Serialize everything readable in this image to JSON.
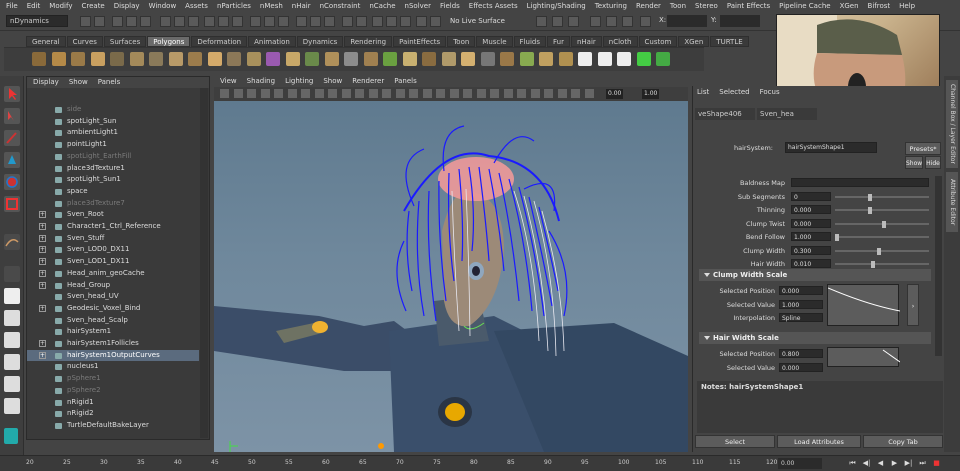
{
  "menubar": [
    "File",
    "Edit",
    "Modify",
    "Create",
    "Display",
    "Window",
    "Assets",
    "nParticles",
    "nMesh",
    "nHair",
    "nConstraint",
    "nCache",
    "nSolver",
    "Fields",
    "Effects Assets",
    "Lighting/Shading",
    "Texturing",
    "Render",
    "Toon",
    "Stereo",
    "Paint Effects",
    "Pipeline Cache",
    "XGen",
    "Bifrost",
    "Help"
  ],
  "status": {
    "mode": "nDynamics",
    "live_surface": "No Live Surface",
    "x_label": "X:",
    "y_label": "Y:"
  },
  "shelf_tabs": [
    "General",
    "Curves",
    "Surfaces",
    "Polygons",
    "Deformation",
    "Animation",
    "Dynamics",
    "Rendering",
    "PaintEffects",
    "Toon",
    "Muscle",
    "Fluids",
    "Fur",
    "nHair",
    "nCloth",
    "Custom",
    "XGen",
    "TURTLE"
  ],
  "shelf_active": "Polygons",
  "outliner": {
    "menu": [
      "Display",
      "Show",
      "Panels"
    ],
    "rows": [
      {
        "label": "side",
        "state": "grey",
        "plus": false
      },
      {
        "label": "spotLight_Sun",
        "state": "",
        "plus": false
      },
      {
        "label": "ambientLight1",
        "state": "",
        "plus": false
      },
      {
        "label": "pointLight1",
        "state": "",
        "plus": false
      },
      {
        "label": "spotLight_EarthFill",
        "state": "grey",
        "plus": false
      },
      {
        "label": "place3dTexture1",
        "state": "",
        "plus": false
      },
      {
        "label": "spotLight_Sun1",
        "state": "",
        "plus": false
      },
      {
        "label": "space",
        "state": "",
        "plus": false
      },
      {
        "label": "place3dTexture7",
        "state": "grey",
        "plus": false
      },
      {
        "label": "Sven_Root",
        "state": "",
        "plus": true
      },
      {
        "label": "Character1_Ctrl_Reference",
        "state": "",
        "plus": true
      },
      {
        "label": "Sven_Stuff",
        "state": "",
        "plus": true
      },
      {
        "label": "Sven_LOD0_DX11",
        "state": "",
        "plus": true
      },
      {
        "label": "Sven_LOD1_DX11",
        "state": "",
        "plus": true
      },
      {
        "label": "Head_anim_geoCache",
        "state": "",
        "plus": true
      },
      {
        "label": "Head_Group",
        "state": "",
        "plus": true
      },
      {
        "label": "Sven_head_UV",
        "state": "",
        "plus": false
      },
      {
        "label": "Geodesic_Voxel_Bind",
        "state": "",
        "plus": true
      },
      {
        "label": "Sven_head_Scalp",
        "state": "",
        "plus": false
      },
      {
        "label": "hairSystem1",
        "state": "",
        "plus": false
      },
      {
        "label": "hairSystem1Follicles",
        "state": "",
        "plus": true
      },
      {
        "label": "hairSystem1OutputCurves",
        "state": "sel",
        "plus": true
      },
      {
        "label": "nucleus1",
        "state": "",
        "plus": false
      },
      {
        "label": "pSphere1",
        "state": "grey",
        "plus": false
      },
      {
        "label": "pSphere2",
        "state": "grey",
        "plus": false
      },
      {
        "label": "nRigid1",
        "state": "",
        "plus": false
      },
      {
        "label": "nRigid2",
        "state": "",
        "plus": false
      },
      {
        "label": "TurtleDefaultBakeLayer",
        "state": "",
        "plus": false
      }
    ]
  },
  "viewport": {
    "menu": [
      "View",
      "Shading",
      "Lighting",
      "Show",
      "Renderer",
      "Panels"
    ],
    "field1": "0.00",
    "field2": "1.00"
  },
  "attr_editor": {
    "menu": [
      "List",
      "Selected",
      "Focus"
    ],
    "tabs": [
      "veShape406",
      "Sven_hea"
    ],
    "node_label": "hairSystem:",
    "node_value": "hairSystemShape1",
    "presets": "Presets*",
    "show": "Show",
    "hide": "Hide",
    "rows": [
      {
        "label": "Baldness Map",
        "value": ""
      },
      {
        "label": "Sub Segments",
        "value": "0"
      },
      {
        "label": "Thinning",
        "value": "0.000"
      },
      {
        "label": "Clump Twist",
        "value": "0.000"
      },
      {
        "label": "Bend Follow",
        "value": "1.000"
      },
      {
        "label": "Clump Width",
        "value": "0.300"
      },
      {
        "label": "Hair Width",
        "value": "0.010"
      }
    ],
    "clump_section": "Clump Width Scale",
    "clump_rows": [
      {
        "label": "Selected Position",
        "value": "0.000"
      },
      {
        "label": "Selected Value",
        "value": "1.000"
      },
      {
        "label": "Interpolation",
        "value": "Spline"
      }
    ],
    "hair_section": "Hair Width Scale",
    "hair_rows": [
      {
        "label": "Selected Position",
        "value": "0.800"
      },
      {
        "label": "Selected Value",
        "value": "0.000"
      }
    ],
    "notes": "Notes:  hairSystemShape1",
    "buttons": [
      "Select",
      "Load Attributes",
      "Copy Tab"
    ]
  },
  "side_tabs": [
    "Channel Box / Layer Editor",
    "Attribute Editor"
  ],
  "timeline": {
    "ticks": [
      "20",
      "25",
      "30",
      "35",
      "40",
      "45",
      "50",
      "55",
      "60",
      "65",
      "70",
      "75",
      "80",
      "85",
      "90",
      "95",
      "100",
      "105",
      "110",
      "115",
      "120"
    ],
    "current": "0.00"
  }
}
